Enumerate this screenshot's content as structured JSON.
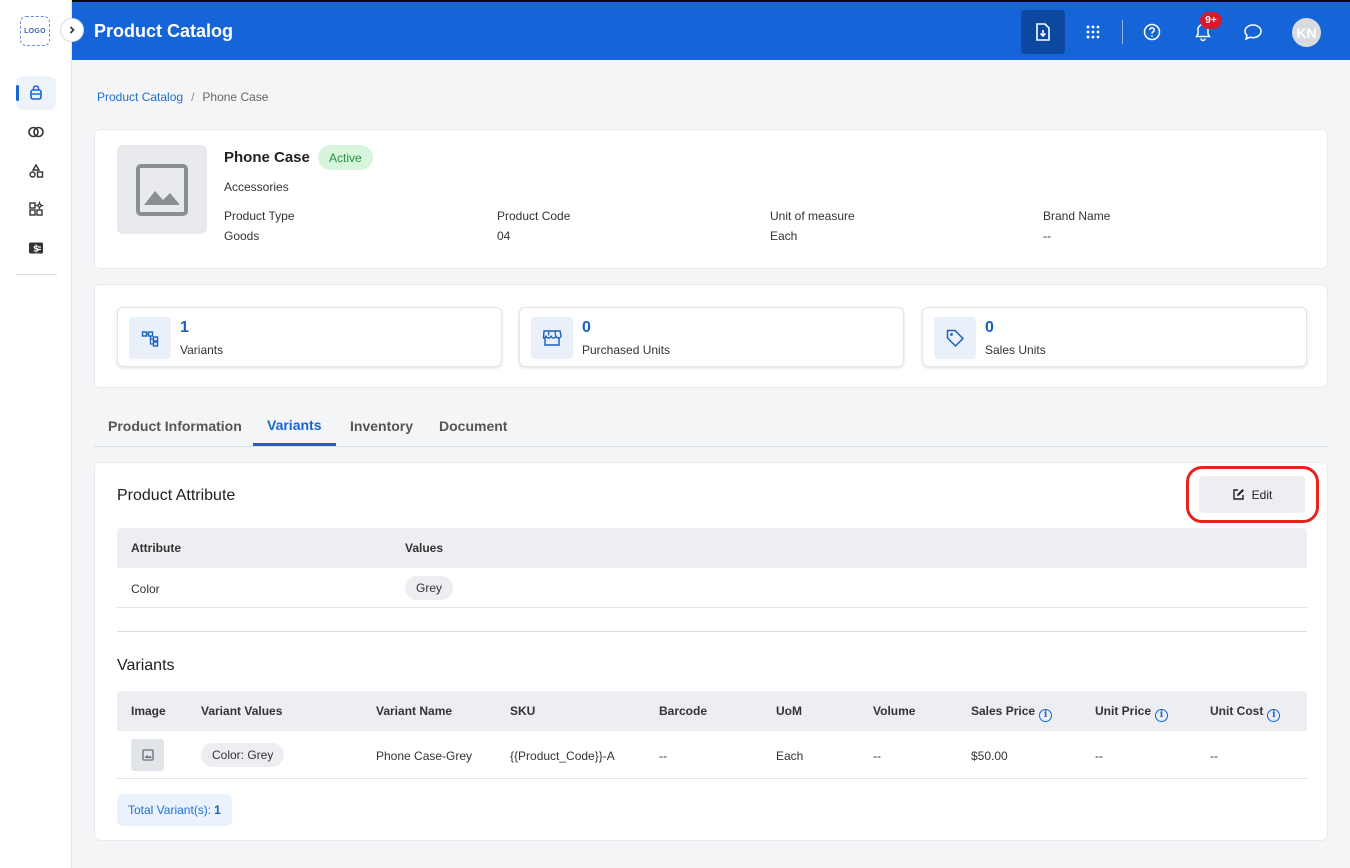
{
  "sidebar": {
    "logo": "LOGO",
    "items": [
      {
        "icon": "catalog-icon",
        "active": true
      },
      {
        "icon": "rings-icon",
        "active": false
      },
      {
        "icon": "shapes-icon",
        "active": false
      },
      {
        "icon": "grid-star-icon",
        "active": false
      },
      {
        "icon": "dollar-card-icon",
        "active": false
      }
    ]
  },
  "header": {
    "title": "Product Catalog",
    "notifications_badge": "9+",
    "avatar_initials": "KN"
  },
  "breadcrumb": {
    "root": "Product Catalog",
    "separator": "/",
    "current": "Phone Case"
  },
  "product": {
    "name": "Phone Case",
    "status": "Active",
    "category": "Accessories",
    "fields": [
      {
        "label": "Product Type",
        "value": "Goods"
      },
      {
        "label": "Product Code",
        "value": "04"
      },
      {
        "label": "Unit of measure",
        "value": "Each"
      },
      {
        "label": "Brand Name",
        "value": "--"
      }
    ]
  },
  "stats": [
    {
      "value": "1",
      "label": "Variants",
      "icon": "variants-icon"
    },
    {
      "value": "0",
      "label": "Purchased Units",
      "icon": "store-icon"
    },
    {
      "value": "0",
      "label": "Sales Units",
      "icon": "tag-icon"
    }
  ],
  "tabs": [
    {
      "label": "Product Information",
      "active": false
    },
    {
      "label": "Variants",
      "active": true
    },
    {
      "label": "Inventory",
      "active": false
    },
    {
      "label": "Document",
      "active": false
    }
  ],
  "attributes": {
    "title": "Product Attribute",
    "edit_label": "Edit",
    "columns": [
      "Attribute",
      "Values"
    ],
    "rows": [
      {
        "attribute": "Color",
        "values": [
          "Grey"
        ]
      }
    ]
  },
  "variants": {
    "title": "Variants",
    "columns": [
      "Image",
      "Variant Values",
      "Variant Name",
      "SKU",
      "Barcode",
      "UoM",
      "Volume",
      "Sales Price",
      "Unit Price",
      "Unit Cost"
    ],
    "info_marker": "i",
    "rows": [
      {
        "variant_values": "Color: Grey",
        "variant_name": "Phone Case-Grey",
        "sku": "{{Product_Code}}-A",
        "barcode": "--",
        "uom": "Each",
        "volume": "--",
        "sales_price": "$50.00",
        "unit_price": "--",
        "unit_cost": "--"
      }
    ],
    "total_label": "Total Variant(s):",
    "total_value": "1"
  },
  "colors": {
    "primary": "#1565d8",
    "header_active": "#0d48a1",
    "status_bg": "#d7f5dd",
    "status_text": "#2e8b3d",
    "badge": "#d81b2c",
    "highlight": "#e8231b"
  }
}
